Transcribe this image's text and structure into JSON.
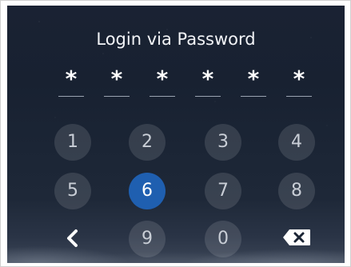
{
  "title": "Login via Password",
  "pin": [
    "*",
    "*",
    "*",
    "*",
    "*",
    "*"
  ],
  "keypad": {
    "keys": [
      "1",
      "2",
      "3",
      "4",
      "5",
      "6",
      "7",
      "8",
      "9",
      "0"
    ],
    "active_key": "6"
  },
  "icons": {
    "back": "chevron-left-icon",
    "delete": "backspace-icon"
  },
  "colors": {
    "active_key": "#1f5fb0",
    "text": "#f2f4f7"
  }
}
